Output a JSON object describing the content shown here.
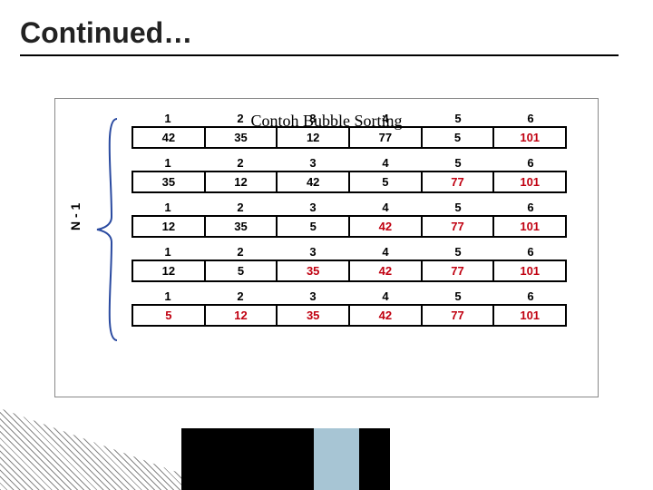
{
  "title": "Continued…",
  "brace_label": "N - 1",
  "caption": "Contoh Bubble Sorting",
  "chart_data": {
    "type": "table",
    "title": "Contoh Bubble Sorting",
    "columns": 6,
    "passes": [
      {
        "indices": [
          "1",
          "2",
          "3",
          "4",
          "5",
          "6"
        ],
        "values": [
          "42",
          "35",
          "12",
          "77",
          "5",
          "101"
        ],
        "highlight": [
          false,
          false,
          false,
          false,
          false,
          true
        ]
      },
      {
        "indices": [
          "1",
          "2",
          "3",
          "4",
          "5",
          "6"
        ],
        "values": [
          "35",
          "12",
          "42",
          "5",
          "77",
          "101"
        ],
        "highlight": [
          false,
          false,
          false,
          false,
          true,
          true
        ]
      },
      {
        "indices": [
          "1",
          "2",
          "3",
          "4",
          "5",
          "6"
        ],
        "values": [
          "12",
          "35",
          "5",
          "42",
          "77",
          "101"
        ],
        "highlight": [
          false,
          false,
          false,
          true,
          true,
          true
        ]
      },
      {
        "indices": [
          "1",
          "2",
          "3",
          "4",
          "5",
          "6"
        ],
        "values": [
          "12",
          "5",
          "35",
          "42",
          "77",
          "101"
        ],
        "highlight": [
          false,
          false,
          true,
          true,
          true,
          true
        ]
      },
      {
        "indices": [
          "1",
          "2",
          "3",
          "4",
          "5",
          "6"
        ],
        "values": [
          "5",
          "12",
          "35",
          "42",
          "77",
          "101"
        ],
        "highlight": [
          true,
          true,
          true,
          true,
          true,
          true
        ]
      }
    ]
  },
  "colors": {
    "highlight": "#c00010",
    "normal": "#000000"
  }
}
